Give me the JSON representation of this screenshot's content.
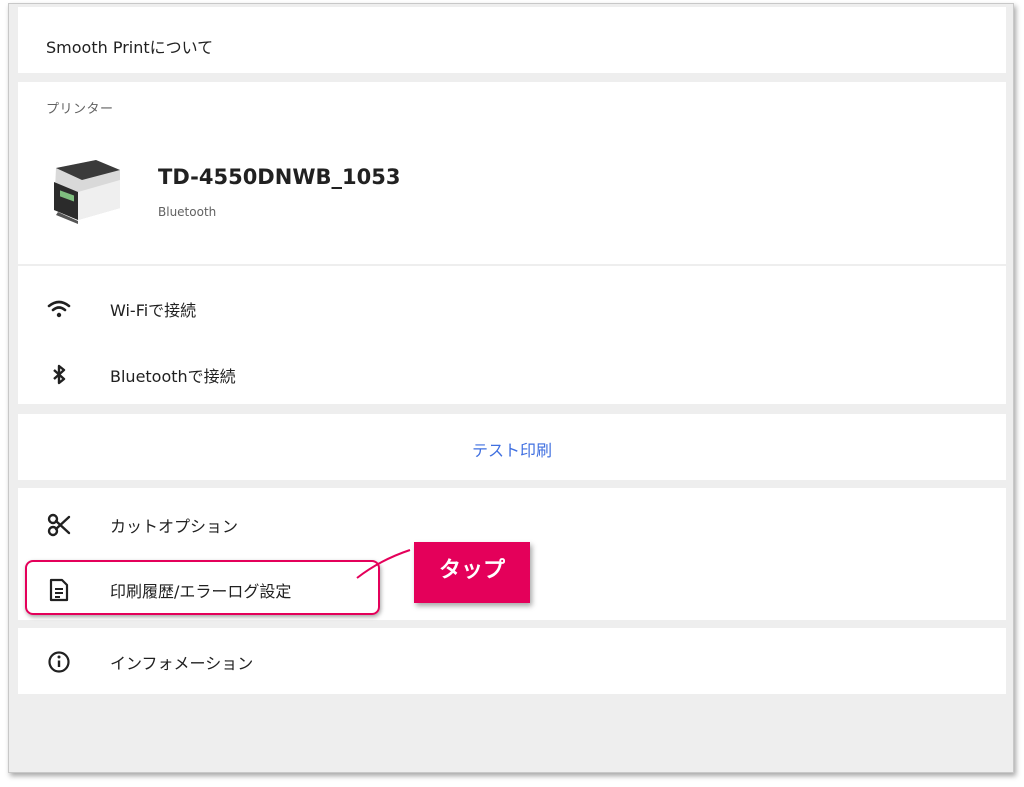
{
  "about": {
    "label": "Smooth Printについて"
  },
  "printer": {
    "section_label": "プリンター",
    "image_icon": "printer-image",
    "name": "TD-4550DNWB_1053",
    "connection": "Bluetooth"
  },
  "connect": {
    "items": [
      {
        "icon": "wifi-icon",
        "label": "Wi-Fiで接続"
      },
      {
        "icon": "bluetooth-icon",
        "label": "Bluetoothで接続"
      }
    ]
  },
  "test_print": {
    "label": "テスト印刷"
  },
  "options": {
    "items": [
      {
        "icon": "scissors-icon",
        "label": "カットオプション"
      },
      {
        "icon": "document-icon",
        "label": "印刷履歴/エラーログ設定"
      }
    ]
  },
  "info": {
    "icon": "info-icon",
    "label": "インフォメーション"
  },
  "annotation": {
    "callout_text": "タップ",
    "accent_color": "#e4005a"
  },
  "colors": {
    "link": "#3f6fe0",
    "background": "#eeeeee",
    "card": "#ffffff"
  }
}
